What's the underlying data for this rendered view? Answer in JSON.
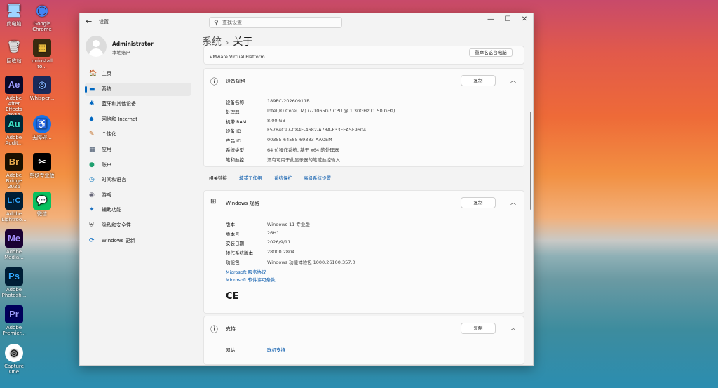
{
  "desktop": {
    "icons": [
      {
        "label": "此电脑",
        "glyph": "🖥"
      },
      {
        "label": "Google Chrome",
        "glyph": "◉"
      },
      {
        "label": "回收站",
        "glyph": "🗑"
      },
      {
        "label": "uninstall to...",
        "glyph": "▦"
      },
      {
        "label": "Adobe After Effects 2026",
        "glyph": "Ae"
      },
      {
        "label": "Whisper...",
        "glyph": "◎"
      },
      {
        "label": "Adobe Audit...",
        "glyph": "Au"
      },
      {
        "label": "无障碍...",
        "glyph": "♿"
      },
      {
        "label": "Adobe Bridge 2026",
        "glyph": "Br"
      },
      {
        "label": "剪映专业版",
        "glyph": "✂"
      },
      {
        "label": "Adobe Lightroo...",
        "glyph": "LrC"
      },
      {
        "label": "微信",
        "glyph": "💬"
      },
      {
        "label": "Adobe Media...",
        "glyph": "Me"
      },
      {
        "label": "Adobe Photosh...",
        "glyph": "Ps"
      },
      {
        "label": "Adobe Premier...",
        "glyph": "Pr"
      },
      {
        "label": "Capture One",
        "glyph": "◎"
      }
    ]
  },
  "window": {
    "title": "设置",
    "back_glyph": "←",
    "search_placeholder": "查找设置",
    "controls": {
      "minimize": "—",
      "maximize": "☐",
      "close": "✕"
    }
  },
  "profile": {
    "name": "Administrator",
    "subtitle": "本地账户"
  },
  "nav": {
    "items": [
      {
        "label": "主页",
        "icon": "🏠"
      },
      {
        "label": "系统",
        "icon": "▬"
      },
      {
        "label": "蓝牙和其他设备",
        "icon": "✱"
      },
      {
        "label": "网络和 Internet",
        "icon": "◆"
      },
      {
        "label": "个性化",
        "icon": "✎"
      },
      {
        "label": "应用",
        "icon": "▦"
      },
      {
        "label": "账户",
        "icon": "●"
      },
      {
        "label": "时间和语言",
        "icon": "◷"
      },
      {
        "label": "游戏",
        "icon": "◉"
      },
      {
        "label": "辅助功能",
        "icon": "✦"
      },
      {
        "label": "隐私和安全性",
        "icon": "⛨"
      },
      {
        "label": "Windows 更新",
        "icon": "⟳"
      }
    ]
  },
  "breadcrumb": {
    "parent": "系统",
    "separator": "›",
    "current": "关于"
  },
  "top_partial": {
    "text": "VMware Virtual Platform",
    "button": "重命名这台电脑"
  },
  "device_specs": {
    "title": "设备规格",
    "copy": "复制",
    "rows": [
      {
        "label": "设备名称",
        "value": "189PC-20260911B"
      },
      {
        "label": "处理器",
        "value": "Intel(R) Core(TM) i7-1065G7 CPU @ 1.30GHz (1.50 GHz)"
      },
      {
        "label": "机带 RAM",
        "value": "8.00 GB"
      },
      {
        "label": "设备 ID",
        "value": "F5784C97-C84F-4682-A78A-F33FEA5F9604"
      },
      {
        "label": "产品 ID",
        "value": "00355-64585-69383-AAOEM"
      },
      {
        "label": "系统类型",
        "value": "64 位操作系统, 基于 x64 的处理器"
      },
      {
        "label": "笔和触控",
        "value": "没有可用于此显示器的笔或触控输入"
      }
    ]
  },
  "related": {
    "label": "相关链接",
    "links": [
      "域或工作组",
      "系统保护",
      "高级系统设置"
    ]
  },
  "windows_specs": {
    "title": "Windows 规格",
    "copy": "复制",
    "rows": [
      {
        "label": "版本",
        "value": "Windows 11 专业版"
      },
      {
        "label": "版本号",
        "value": "26H1"
      },
      {
        "label": "安装日期",
        "value": "2026/9/11"
      },
      {
        "label": "操作系统版本",
        "value": "28000.2804"
      },
      {
        "label": "功能包",
        "value": "Windows 功能体验包 1000.26100.357.0"
      }
    ],
    "links": [
      "Microsoft 服务协议",
      "Microsoft 软件许可条款"
    ],
    "ce": "CE"
  },
  "support": {
    "title": "支持",
    "copy": "复制",
    "rows": [
      {
        "label": "网站",
        "value": "联机支持"
      }
    ]
  }
}
